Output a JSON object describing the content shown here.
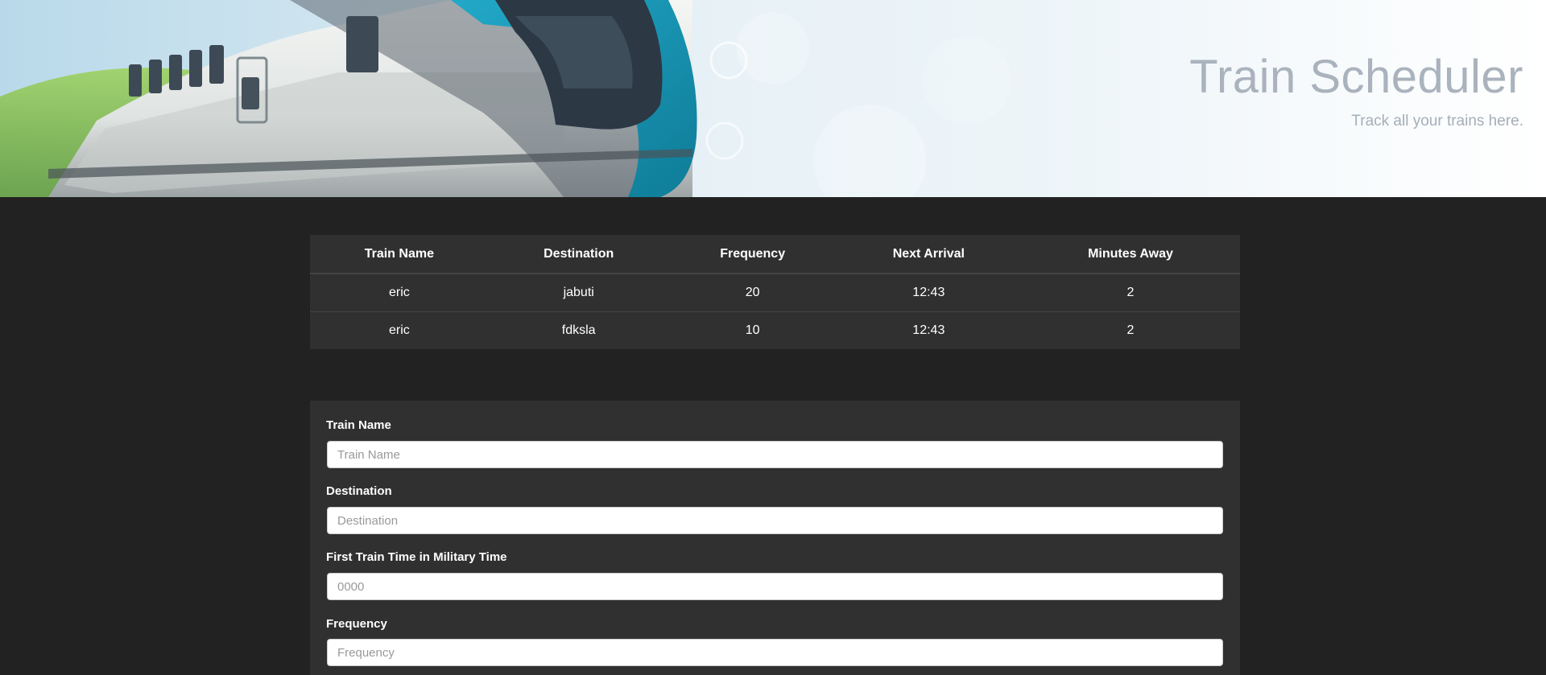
{
  "header": {
    "title": "Train Scheduler",
    "subtitle": "Track all your trains here."
  },
  "schedule": {
    "columns": [
      "Train Name",
      "Destination",
      "Frequency",
      "Next Arrival",
      "Minutes Away"
    ],
    "rows": [
      {
        "name": "eric",
        "destination": "jabuti",
        "frequency": "20",
        "next_arrival": "12:43",
        "minutes_away": "2"
      },
      {
        "name": "eric",
        "destination": "fdksla",
        "frequency": "10",
        "next_arrival": "12:43",
        "minutes_away": "2"
      }
    ]
  },
  "form": {
    "train_name": {
      "label": "Train Name",
      "placeholder": "Train Name",
      "value": ""
    },
    "destination": {
      "label": "Destination",
      "placeholder": "Destination",
      "value": ""
    },
    "first_train": {
      "label": "First Train Time in Military Time",
      "placeholder": "0000",
      "value": ""
    },
    "frequency": {
      "label": "Frequency",
      "placeholder": "Frequency",
      "value": ""
    }
  },
  "colors": {
    "page_background": "#222222",
    "panel_background": "#303030",
    "title_color": "#aab3bd",
    "train_accent": "#1797b4"
  }
}
